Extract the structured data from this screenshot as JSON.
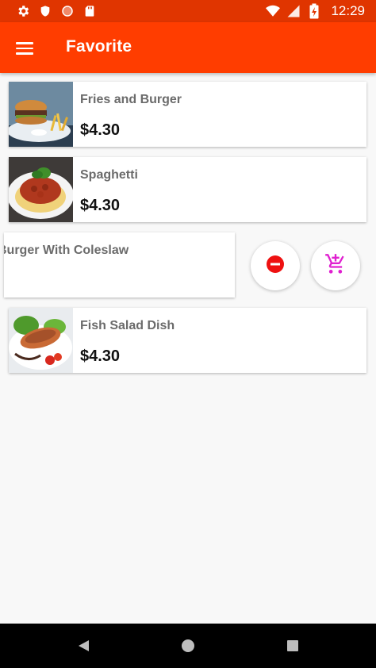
{
  "status_bar": {
    "time": "12:29",
    "icons_left": [
      "settings-icon",
      "shield-icon",
      "circle-icon",
      "sd-card-icon"
    ],
    "icons_right": [
      "wifi-icon",
      "signal-icon",
      "battery-charging-icon"
    ]
  },
  "app_bar": {
    "title": "Favorite",
    "menu_icon": "hamburger-menu-icon",
    "color": "#ff3d00"
  },
  "items": [
    {
      "name": "Fries and Burger",
      "price": "$4.30"
    },
    {
      "name": "Spaghetti",
      "price": "$4.30"
    },
    {
      "name": "Burger With Coleslaw",
      "price": ""
    },
    {
      "name": "Fish Salad Dish",
      "price": "$4.30"
    }
  ],
  "swipe_actions": {
    "remove_icon": "remove-circle-icon",
    "add_to_cart_icon": "add-shopping-cart-icon",
    "remove_color": "#ee1111",
    "cart_color": "#e020d0"
  },
  "nav_bar": {
    "buttons": [
      "back-icon",
      "home-icon",
      "recents-icon"
    ]
  }
}
